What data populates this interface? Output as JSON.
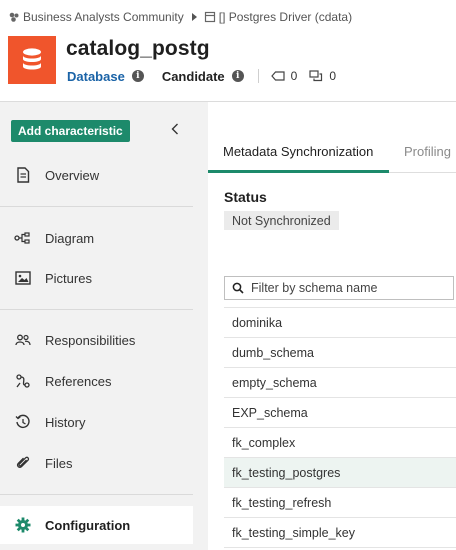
{
  "breadcrumb": {
    "community": "Business Analysts Community",
    "domain": "[] Postgres Driver (cdata)"
  },
  "asset": {
    "title": "catalog_postg",
    "type": "Database",
    "status": "Candidate",
    "tags_count": "0",
    "comments_count": "0",
    "icon": "database-icon",
    "icon_color": "#f0552c"
  },
  "sidebar": {
    "add_button": "Add characteristic",
    "items": [
      {
        "label": "Overview",
        "icon": "document-icon"
      },
      {
        "label": "Diagram",
        "icon": "diagram-icon"
      },
      {
        "label": "Pictures",
        "icon": "pictures-icon"
      },
      {
        "label": "Responsibilities",
        "icon": "people-icon"
      },
      {
        "label": "References",
        "icon": "references-icon"
      },
      {
        "label": "History",
        "icon": "history-icon"
      },
      {
        "label": "Files",
        "icon": "paperclip-icon"
      },
      {
        "label": "Configuration",
        "icon": "gear-icon",
        "active": true
      }
    ]
  },
  "main": {
    "tabs": [
      {
        "label": "Metadata Synchronization",
        "active": true
      },
      {
        "label": "Profiling",
        "active": false
      }
    ],
    "status_heading": "Status",
    "status_value": "Not Synchronized",
    "filter_placeholder": "Filter by schema name",
    "schemas": [
      "dominika",
      "dumb_schema",
      "empty_schema",
      "EXP_schema",
      "fk_complex",
      "fk_testing_postgres",
      "fk_testing_refresh",
      "fk_testing_simple_key"
    ]
  },
  "colors": {
    "accent": "#1d8a6b",
    "link": "#1a63a7",
    "sidebar_bg": "#f2f2f2"
  }
}
